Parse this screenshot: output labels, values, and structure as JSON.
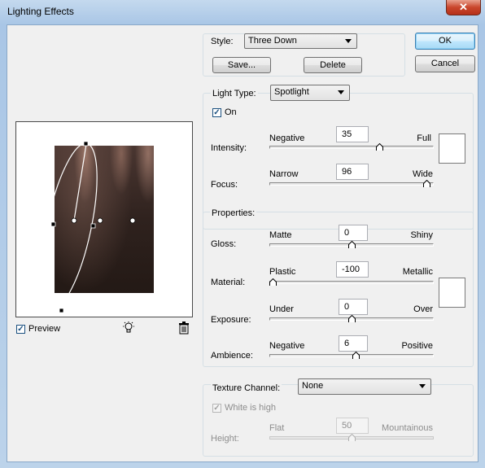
{
  "window": {
    "title": "Lighting Effects",
    "close_symbol": "✕"
  },
  "style": {
    "label": "Style:",
    "value": "Three Down",
    "save_label": "Save...",
    "delete_label": "Delete"
  },
  "buttons": {
    "ok": "OK",
    "cancel": "Cancel"
  },
  "light_type": {
    "label": "Light Type:",
    "value": "Spotlight",
    "on_label": "On",
    "on_checked": true,
    "intensity": {
      "label": "Intensity:",
      "left": "Negative",
      "right": "Full",
      "value": "35",
      "level": 0.68
    },
    "focus": {
      "label": "Focus:",
      "left": "Narrow",
      "right": "Wide",
      "value": "96",
      "level": 0.98
    },
    "light_color": "#ffffff"
  },
  "properties": {
    "label": "Properties:",
    "gloss": {
      "label": "Gloss:",
      "left": "Matte",
      "right": "Shiny",
      "value": "0",
      "level": 0.5
    },
    "material": {
      "label": "Material:",
      "left": "Plastic",
      "right": "Metallic",
      "value": "-100",
      "level": 0.0
    },
    "exposure": {
      "label": "Exposure:",
      "left": "Under",
      "right": "Over",
      "value": "0",
      "level": 0.5
    },
    "ambience": {
      "label": "Ambience:",
      "left": "Negative",
      "right": "Positive",
      "value": "6",
      "level": 0.53
    },
    "ambient_color": "#ffffff"
  },
  "texture": {
    "label": "Texture Channel:",
    "value": "None",
    "white_is_high_label": "White is high",
    "white_is_high_checked": true,
    "height": {
      "label": "Height:",
      "left": "Flat",
      "right": "Mountainous",
      "value": "50",
      "level": 0.5
    }
  },
  "preview_panel": {
    "preview_label": "Preview",
    "preview_checked": true,
    "new_light_icon": "lightbulb-icon",
    "delete_light_icon": "trash-icon"
  },
  "colors": {
    "title_bar": "#a9c6e6",
    "close_button": "#c9462c",
    "default_button": "#bee6fd"
  }
}
